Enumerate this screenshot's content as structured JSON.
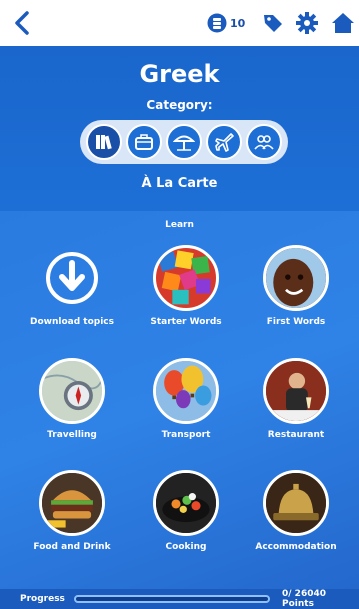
{
  "topbar": {
    "coin_count": "10"
  },
  "header": {
    "title": "Greek",
    "category_label": "Category:",
    "categories": [
      "library",
      "business",
      "beach",
      "travel",
      "people"
    ],
    "selected_category": "À La Carte"
  },
  "learn_label": "Learn",
  "tiles": [
    {
      "label": "Download topics",
      "icon": "download-icon"
    },
    {
      "label": "Starter Words",
      "icon": "letters-image"
    },
    {
      "label": "First Words",
      "icon": "child-image"
    },
    {
      "label": "Travelling",
      "icon": "compass-image"
    },
    {
      "label": "Transport",
      "icon": "balloons-image"
    },
    {
      "label": "Restaurant",
      "icon": "diner-image"
    },
    {
      "label": "Food and Drink",
      "icon": "burger-image"
    },
    {
      "label": "Cooking",
      "icon": "wok-image"
    },
    {
      "label": "Accommodation",
      "icon": "bell-image"
    }
  ],
  "progress": {
    "label": "Progress",
    "value": 0,
    "points_text": "0/ 26040 Points"
  },
  "colors": {
    "primary": "#1d6fd6",
    "dark": "#1a4fa8",
    "progress": "#8ec0ff"
  }
}
